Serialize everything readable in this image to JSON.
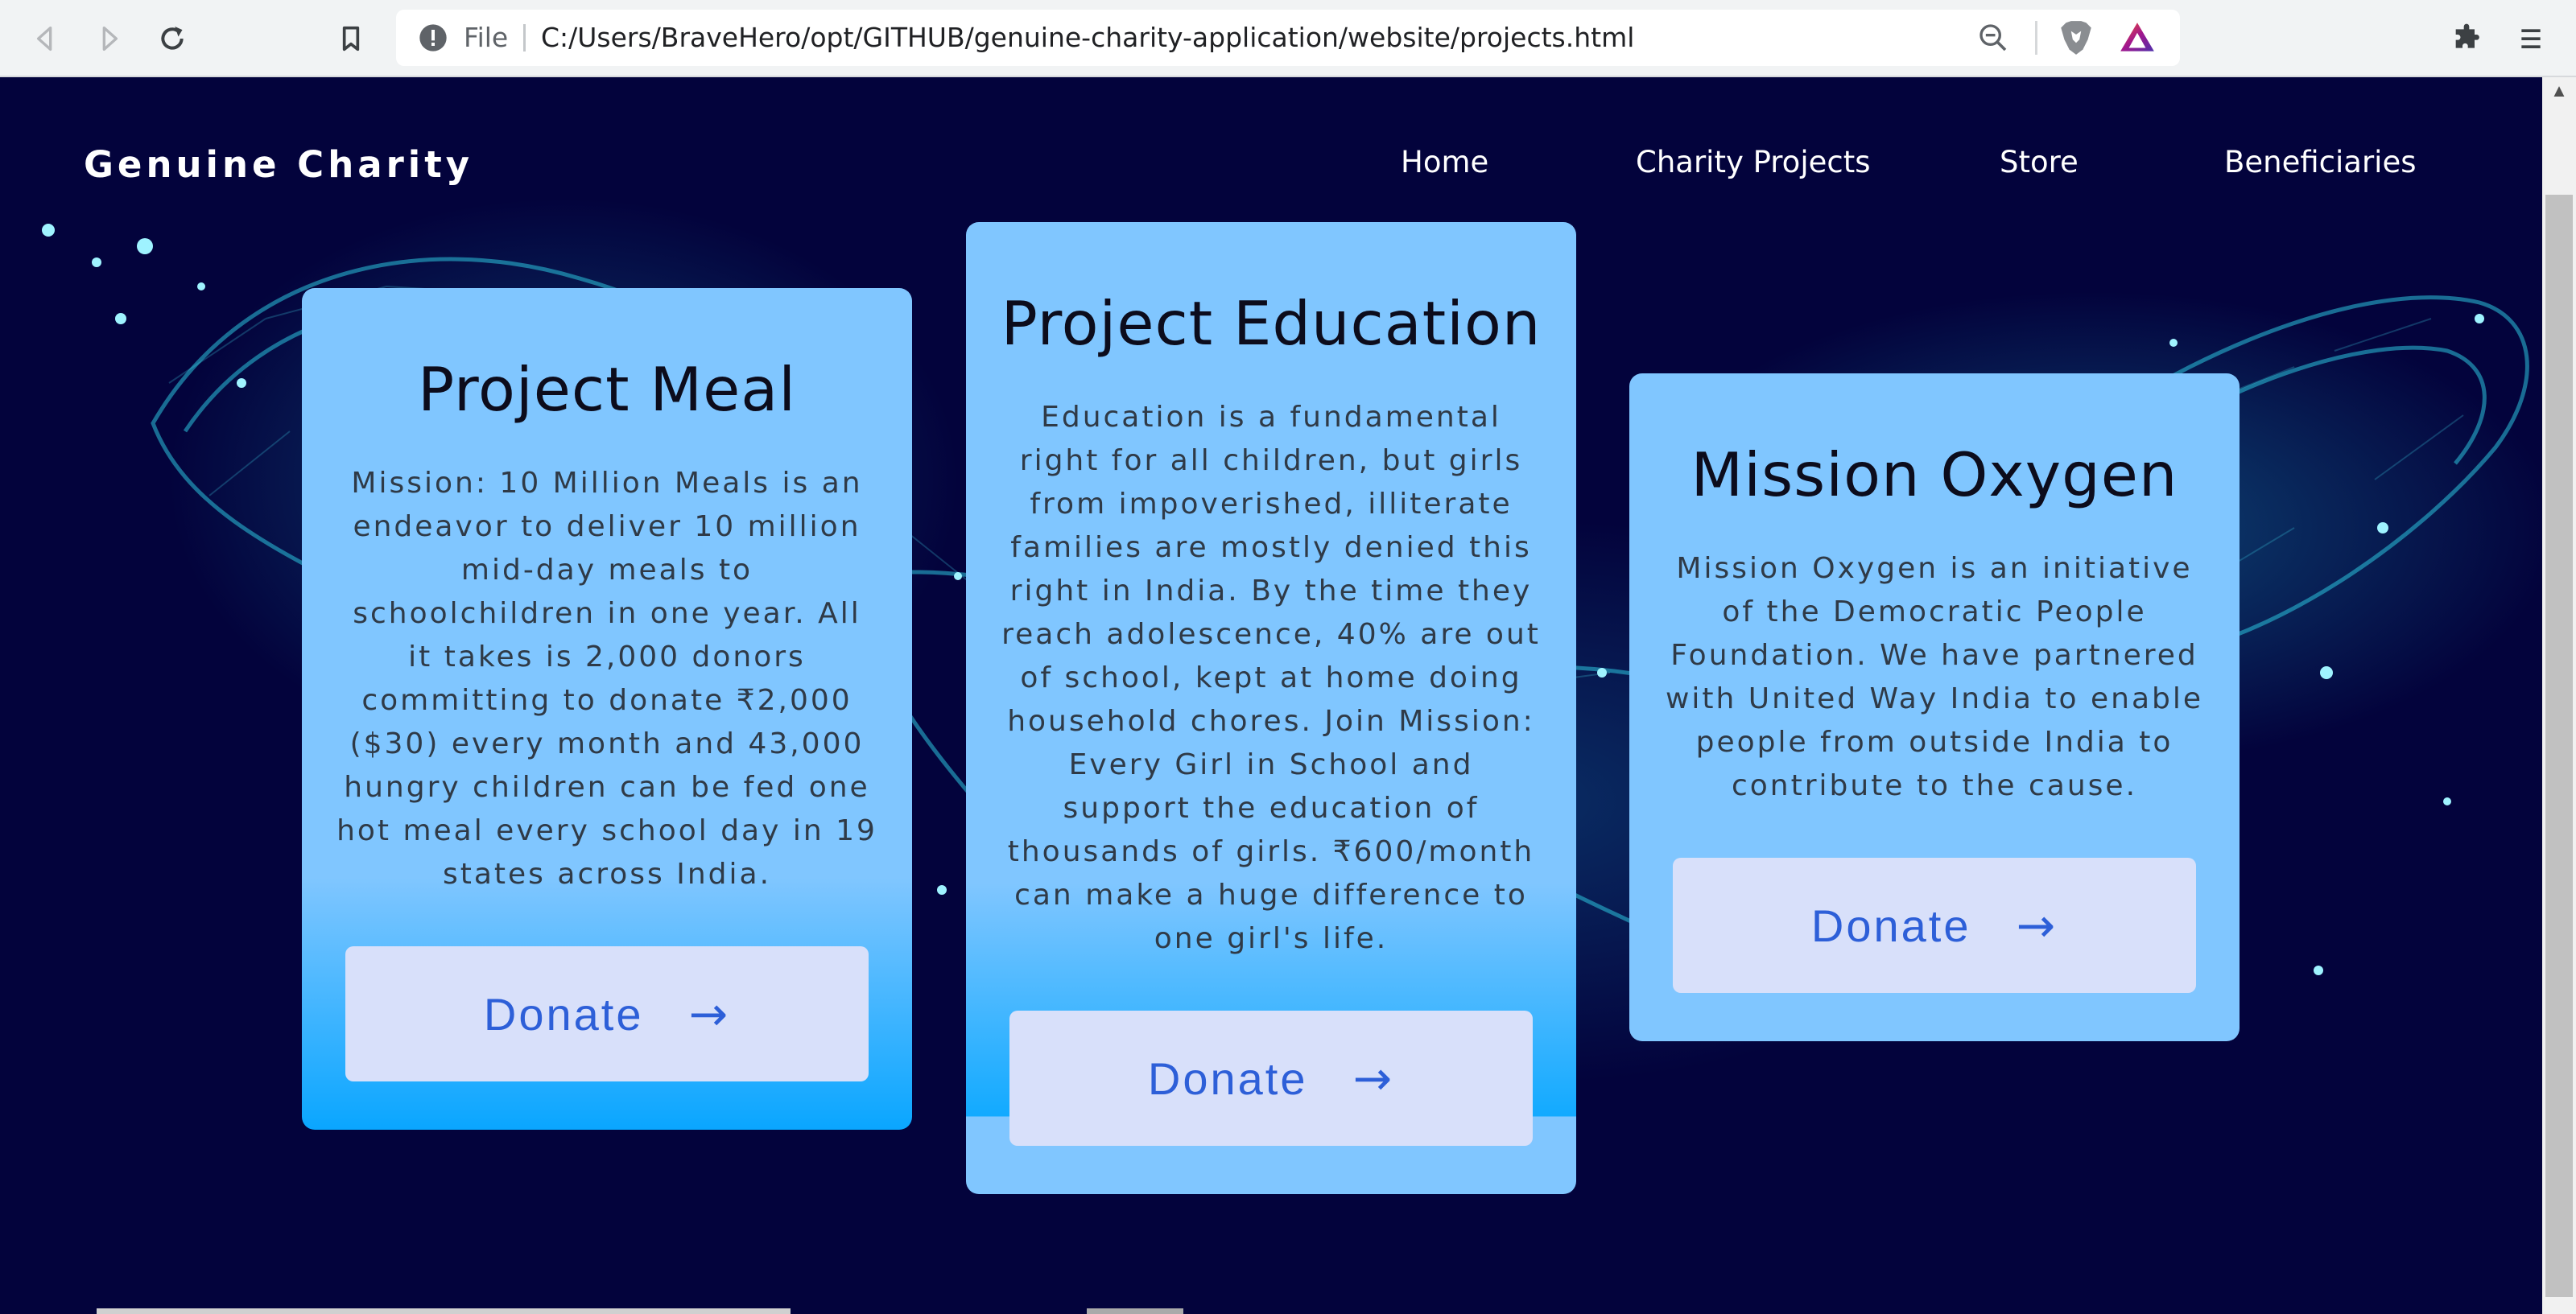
{
  "browser": {
    "back_icon": "back-arrow-icon",
    "forward_icon": "forward-arrow-icon",
    "reload_icon": "reload-icon",
    "bookmark_icon": "bookmark-icon",
    "site_info_label": "File",
    "url": "C:/Users/BraveHero/opt/GITHUB/genuine-charity-application/website/projects.html",
    "zoom_icon": "zoom-out-icon",
    "shields_icon": "brave-shields-icon",
    "rewards_icon": "brave-rewards-icon",
    "extensions_icon": "extensions-icon",
    "menu_icon": "menu-icon"
  },
  "site": {
    "brand": "Genuine Charity",
    "nav": [
      {
        "label": "Home"
      },
      {
        "label": "Charity Projects"
      },
      {
        "label": "Store"
      },
      {
        "label": "Beneficiaries"
      }
    ]
  },
  "projects": [
    {
      "title": "Project Meal",
      "description_lines": [
        "Mission: 10 Million Meals is an",
        "endeavor to deliver 10 million",
        "mid-day meals to",
        "schoolchildren in one year. All",
        "it takes is 2,000 donors",
        "committing to donate ₹2,000",
        "($30) every month and 43,000",
        "hungry children can be fed one",
        "hot meal every school day in 19",
        "states across India."
      ],
      "button_label": "Donate",
      "button_arrow": "→"
    },
    {
      "title": "Project Education",
      "description_lines": [
        "Education is a fundamental",
        "right for all children, but girls",
        "from impoverished, illiterate",
        "families are mostly denied this",
        "right in India. By the time they",
        "reach adolescence, 40% are out",
        "of school, kept at home doing",
        "household chores. Join Mission:",
        "Every Girl in School and",
        "support the education of",
        "thousands of girls. ₹600/month",
        "can make a huge difference to",
        "one girl's life."
      ],
      "button_label": "Donate",
      "button_arrow": "→"
    },
    {
      "title": "Mission Oxygen",
      "description_lines": [
        "Mission Oxygen is an initiative",
        "of the Democratic People",
        "Foundation. We have partnered",
        "with United Way India to enable",
        "people from outside India to",
        "contribute to the cause."
      ],
      "button_label": "Donate",
      "button_arrow": "→"
    }
  ],
  "colors": {
    "page_bg": "#03033c",
    "card_bg": "#80c6ff",
    "card_gradient_end": "#0aa6ff",
    "button_bg": "#d8e0fa",
    "button_text": "#2d5fd8"
  }
}
